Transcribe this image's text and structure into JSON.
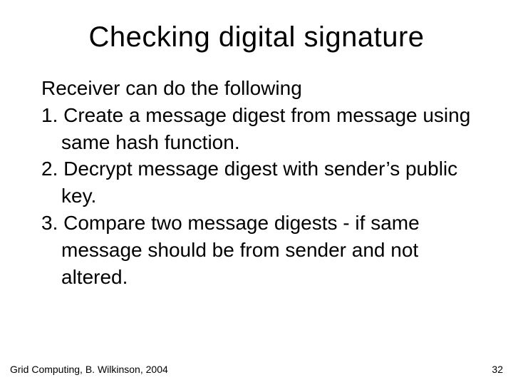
{
  "title": "Checking digital signature",
  "intro": "Receiver can do the following",
  "items": [
    "1. Create a message digest from message using same hash function.",
    "2. Decrypt message digest with sender’s public key.",
    "3. Compare two message digests - if same message should be from sender and not altered."
  ],
  "footer": {
    "left": "Grid Computing, B. Wilkinson, 2004",
    "right": "32"
  }
}
